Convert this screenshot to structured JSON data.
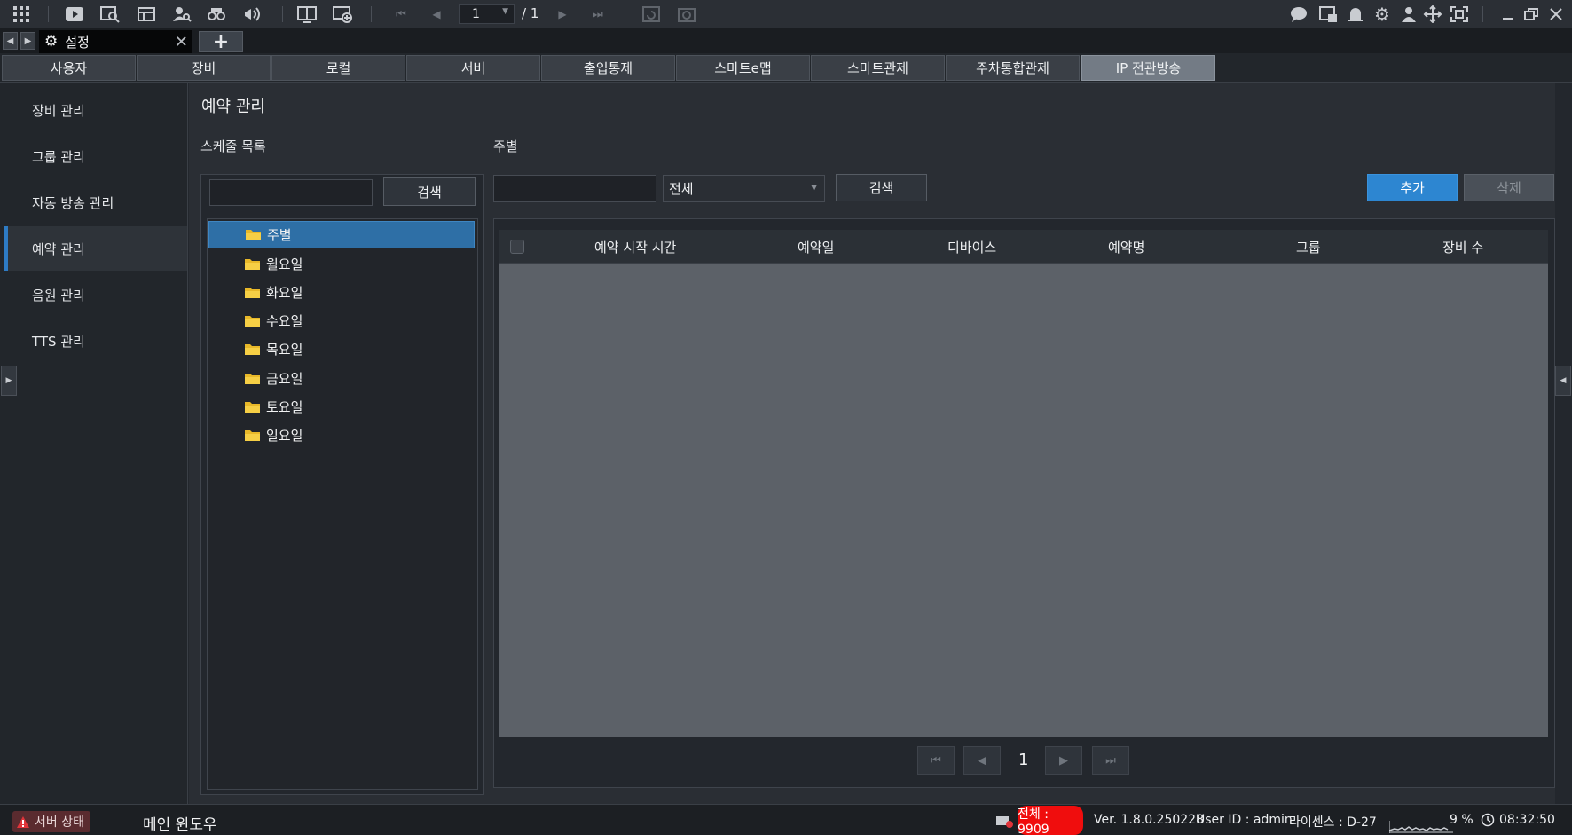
{
  "toolbar": {
    "icons": [
      "apps-grid-icon",
      "play-icon",
      "playback-search-icon",
      "map-icon",
      "user-search-icon",
      "camera-icon",
      "broadcast-icon",
      "layout-icon",
      "add-screen-icon",
      "first-page-icon",
      "prev-page-icon",
      "next-page-icon",
      "last-page-icon",
      "refresh-icon",
      "snapshot-icon",
      "chat-icon",
      "event-icon",
      "alarm-icon",
      "gear-icon",
      "user-icon",
      "move-icon",
      "fullscreen-icon",
      "minimize-icon",
      "restore-icon",
      "close-icon"
    ],
    "page_current": "1",
    "page_total": "/ 1"
  },
  "tabstrip": {
    "tab_label": "설정",
    "add_label": "+"
  },
  "categories": [
    "사용자",
    "장비",
    "로컬",
    "서버",
    "출입통제",
    "스마트e맵",
    "스마트관제",
    "주차통합관제",
    "IP 전관방송"
  ],
  "active_category": "IP 전관방송",
  "sidebar": {
    "items": [
      "장비 관리",
      "그룹 관리",
      "자동 방송 관리",
      "예약 관리",
      "음원 관리",
      "TTS 관리"
    ],
    "active": "예약 관리"
  },
  "main": {
    "title": "예약 관리",
    "schedule_list_label": "스케줄 목록",
    "current_folder_label": "주별",
    "left_search_button": "검색",
    "tree": [
      "주별",
      "월요일",
      "화요일",
      "수요일",
      "목요일",
      "금요일",
      "토요일",
      "일요일"
    ],
    "selected_tree": "주별",
    "filter_select": "전체",
    "right_search_button": "검색",
    "add_button": "추가",
    "delete_button": "삭제",
    "columns": [
      "예약 시작 시간",
      "예약일",
      "디바이스",
      "예약명",
      "그룹",
      "장비 수"
    ],
    "pager": {
      "first": "⏮",
      "prev": "◀",
      "page": "1",
      "next": "▶",
      "last": "⏭"
    }
  },
  "statusbar": {
    "server_status": "서버 상태",
    "main_window": "메인 윈도우",
    "total": "전체 : 9909",
    "version": "Ver. 1.8.0.250228",
    "user_id": "User ID : admin",
    "license": "라이센스 : D-27",
    "cpu": "9 %",
    "time": "08:32:50"
  },
  "colors": {
    "accent": "#2d86d1",
    "selected_tree": "#2e6fa6",
    "total_badge": "#f00d0d",
    "active_tab": "#737b85"
  }
}
